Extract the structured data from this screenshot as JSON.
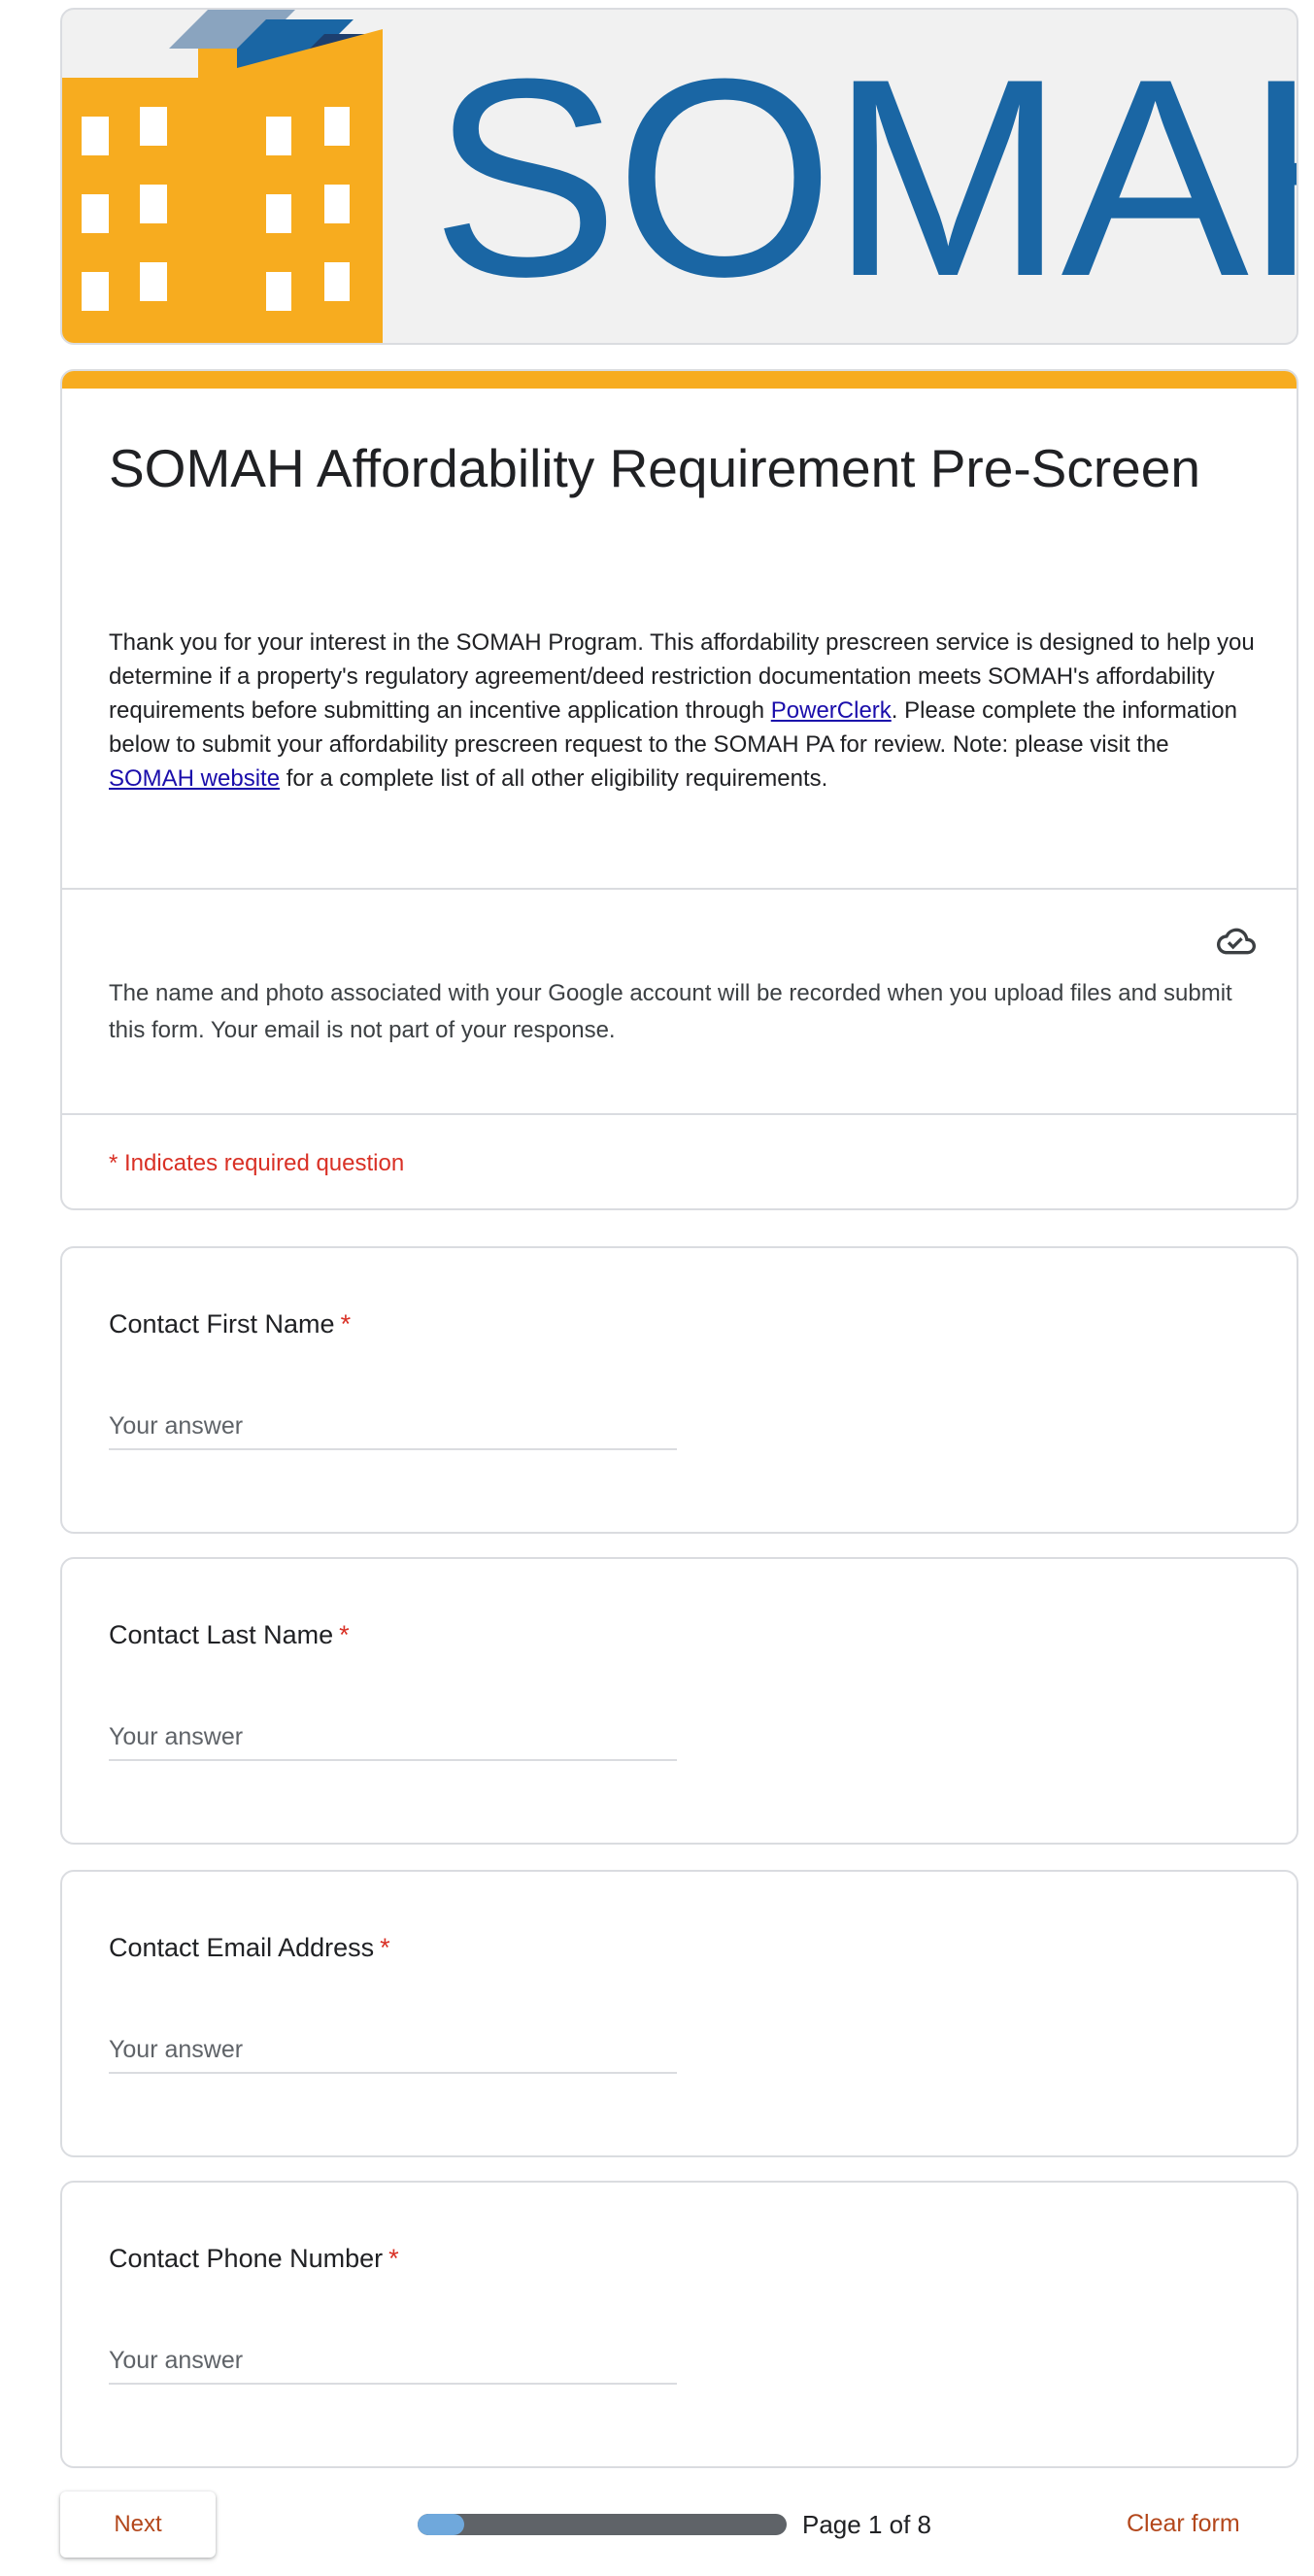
{
  "banner": {
    "logo_text": "SOMAH"
  },
  "form": {
    "title": "SOMAH Affordability Requirement Pre-Screen",
    "description_parts": {
      "p1": "Thank you for your interest in the SOMAH Program. This affordability prescreen service is designed to help you determine if a property's regulatory agreement/deed restriction documentation meets SOMAH's affordability requirements before submitting an incentive application through ",
      "link1": "PowerClerk",
      "p2": ". Please complete the information below to submit your affordability prescreen request to the SOMAH PA for review. Note: please visit the ",
      "link2": "SOMAH website",
      "p3": " for a complete list of all other eligibility requirements."
    },
    "account_note": "The name and photo associated with your Google account will be recorded when you upload files and submit this form. Your email is not part of your response.",
    "required_note": "* Indicates required question"
  },
  "questions": [
    {
      "label": "Contact First Name",
      "required_mark": "*",
      "placeholder": "Your answer"
    },
    {
      "label": "Contact Last Name",
      "required_mark": "*",
      "placeholder": "Your answer"
    },
    {
      "label": "Contact Email Address",
      "required_mark": "*",
      "placeholder": "Your answer"
    },
    {
      "label": "Contact Phone Number",
      "required_mark": "*",
      "placeholder": "Your answer"
    }
  ],
  "footer": {
    "next_label": "Next",
    "page_indicator": "Page 1 of 8",
    "progress_fraction": 0.125,
    "clear_label": "Clear form"
  },
  "icons": {
    "cloud": "cloud-check-icon"
  },
  "colors": {
    "accent": "#f7ac1f",
    "brand_blue": "#1a66a4",
    "button_text": "#b3471b",
    "required": "#d93025"
  }
}
